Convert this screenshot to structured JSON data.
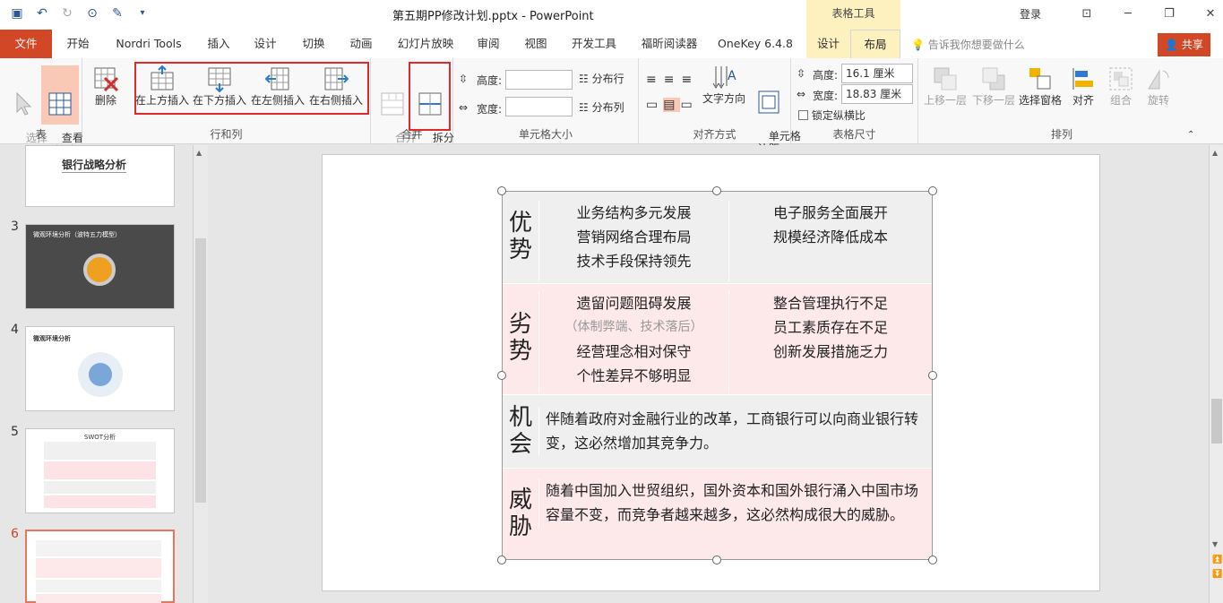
{
  "titlebar": {
    "title": "第五期PP修改计划.pptx - PowerPoint",
    "table_tools": "表格工具",
    "login": "登录",
    "qat_icons": [
      "save-icon",
      "undo-icon",
      "redo-icon",
      "present-icon",
      "touch-icon",
      "more-icon"
    ]
  },
  "tabs": {
    "file": "文件",
    "home": "开始",
    "nordri": "Nordri Tools",
    "insert": "插入",
    "design": "设计",
    "transitions": "切换",
    "animations": "动画",
    "slideshow": "幻灯片放映",
    "review": "审阅",
    "view": "视图",
    "developer": "开发工具",
    "foxit": "福昕阅读器",
    "onekey": "OneKey 6.4.8",
    "table_design": "设计",
    "layout": "布局",
    "tell_me": "告诉我你想要做什么",
    "share": "共享"
  },
  "ribbon": {
    "table_group": {
      "label": "表",
      "select": "选择",
      "gridlines": "查看\n网格线"
    },
    "rows_cols_group": {
      "label": "行和列",
      "delete": "删除",
      "insert_above": "在上方插入",
      "insert_below": "在下方插入",
      "insert_left": "在左侧插入",
      "insert_right": "在右侧插入"
    },
    "merge_group": {
      "label": "合并",
      "merge_cells": "合并\n单元格",
      "split_cells": "拆分\n单元格"
    },
    "cell_size_group": {
      "label": "单元格大小",
      "height_label": "高度:",
      "width_label": "宽度:",
      "height_value": "",
      "width_value": "",
      "distribute_rows": "分布行",
      "distribute_cols": "分布列"
    },
    "alignment_group": {
      "label": "对齐方式",
      "text_direction": "文字方向",
      "cell_margins": "单元格\n边距"
    },
    "table_size_group": {
      "label": "表格尺寸",
      "height_label": "高度:",
      "width_label": "宽度:",
      "height_value": "16.1 厘米",
      "width_value": "18.83 厘米",
      "lock_ratio": "锁定纵横比"
    },
    "arrange_group": {
      "label": "排列",
      "bring_forward": "上移一层",
      "send_backward": "下移一层",
      "selection_pane": "选择窗格",
      "align": "对齐",
      "group": "组合",
      "rotate": "旋转"
    }
  },
  "thumbnails": [
    {
      "number": "",
      "title": "银行战略分析"
    },
    {
      "number": "3",
      "title": "微观环境分析（波特五力模型）"
    },
    {
      "number": "4",
      "title": "微观环境分析"
    },
    {
      "number": "5",
      "title": "SWOT分析"
    },
    {
      "number": "6",
      "title": ""
    }
  ],
  "swot": {
    "strengths": {
      "head": "优\n势",
      "left": [
        "业务结构多元发展",
        "营销网络合理布局",
        "技术手段保持领先"
      ],
      "right": [
        "电子服务全面展开",
        "规模经济降低成本"
      ]
    },
    "weaknesses": {
      "head": "劣\n势",
      "left1": "遗留问题阻碍发展",
      "left_note": "（体制弊端、技术落后）",
      "left2": "经营理念相对保守",
      "left3": "个性差异不够明显",
      "right": [
        "整合管理执行不足",
        "员工素质存在不足",
        "创新发展措施乏力"
      ]
    },
    "opportunities": {
      "head": "机\n会",
      "text": "伴随着政府对金融行业的改革，工商银行可以向商业银行转变，这必然增加其竞争力。"
    },
    "threats": {
      "head": "威\n胁",
      "text": "随着中国加入世贸组织，国外资本和国外银行涌入中国市场容量不变，而竞争者越来越多，这必然构成很大的威胁。"
    }
  },
  "colors": {
    "accent": "#d24726",
    "table_tools": "#fdf2bf",
    "row_gray": "#efefef",
    "row_pink": "#fde8ea",
    "highlight_box": "#e0292a"
  }
}
